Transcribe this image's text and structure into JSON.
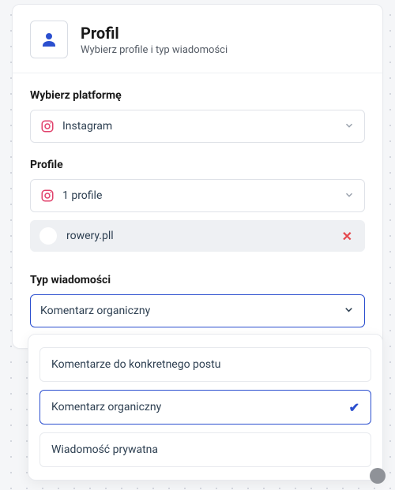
{
  "header": {
    "title": "Profil",
    "subtitle": "Wybierz profile i typ wiadomości"
  },
  "platform": {
    "label": "Wybierz platformę",
    "value": "Instagram"
  },
  "profile": {
    "label": "Profile",
    "value": "1 profile",
    "selected_name": "rowery.pll"
  },
  "message_type": {
    "label": "Typ wiadomości",
    "value": "Komentarz organiczny",
    "options": [
      "Komentarze do konkretnego postu",
      "Komentarz organiczny",
      "Wiadomość prywatna"
    ]
  },
  "icons": {
    "profile": "person-icon",
    "instagram": "instagram-icon"
  },
  "colors": {
    "primary": "#2b4fcf",
    "danger": "#e5484d",
    "instagram": "#e1426c"
  }
}
